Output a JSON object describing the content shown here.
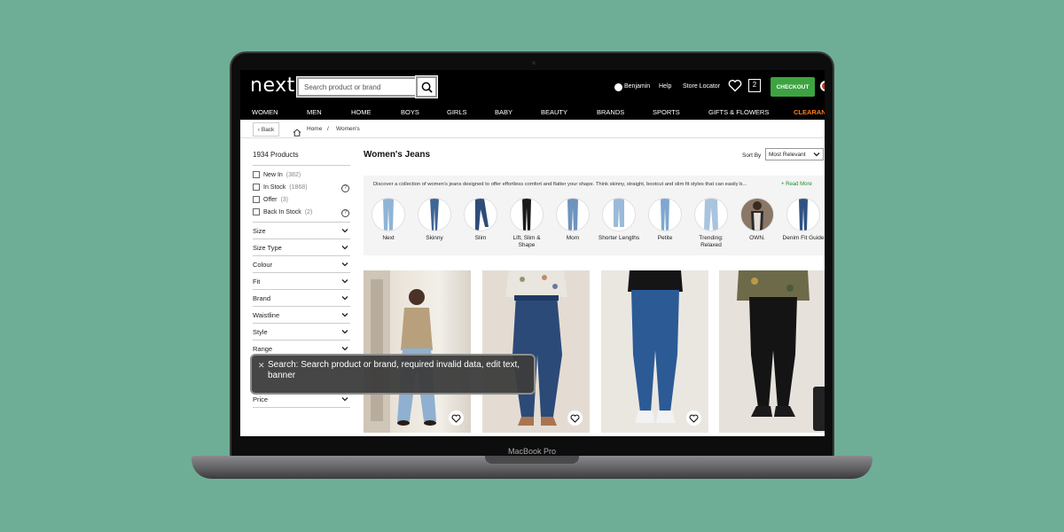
{
  "device": {
    "label": "MacBook Pro"
  },
  "header": {
    "logo": "next",
    "search_placeholder": "Search product or brand",
    "user_name": "Benjamin",
    "help": "Help",
    "store_locator": "Store Locator",
    "bag_count": "2",
    "checkout": "CHECKOUT"
  },
  "nav": [
    "WOMEN",
    "MEN",
    "HOME",
    "BOYS",
    "GIRLS",
    "BABY",
    "BEAUTY",
    "BRANDS",
    "SPORTS",
    "GIFTS & FLOWERS",
    "CLEARAN"
  ],
  "breadcrumb": {
    "back": "Back",
    "home": "Home",
    "separator": "/",
    "current": "Women's"
  },
  "sidebar": {
    "product_count": "1934 Products",
    "checkboxes": [
      {
        "label": "New In",
        "count": "(382)"
      },
      {
        "label": "In Stock",
        "count": "(1868)"
      },
      {
        "label": "Offer",
        "count": "(3)"
      },
      {
        "label": "Back In Stock",
        "count": "(2)"
      }
    ],
    "filters": [
      "Size",
      "Size Type",
      "Colour",
      "Fit",
      "Brand",
      "Waistline",
      "Style",
      "Range",
      "Price"
    ]
  },
  "main": {
    "title": "Women's Jeans",
    "sort_label": "Sort By",
    "sort_value": "Most Relevant",
    "promo_text": "Discover a collection of women's jeans designed to offer effortless comfort and flatter your shape. Think skinny, straight, bootcut and slim fit styles that can easily b...",
    "read_more": "+ Read More",
    "categories": [
      {
        "label": "Next",
        "color": "#8fb4d6"
      },
      {
        "label": "Skinny",
        "color": "#3f6594"
      },
      {
        "label": "Slim",
        "color": "#2e4d78"
      },
      {
        "label": "Lift, Slim & Shape",
        "color": "#1a1a1a"
      },
      {
        "label": "Mom",
        "color": "#6e93bd"
      },
      {
        "label": "Shorter Lengths",
        "color": "#9bbad9"
      },
      {
        "label": "Petite",
        "color": "#7fa6cf"
      },
      {
        "label": "Trending: Relaxed",
        "color": "#a9c4df"
      },
      {
        "label": "OWN.",
        "color": "#3a2a22"
      },
      {
        "label": "Denim Fit Guide",
        "color": "#2f5283"
      }
    ]
  },
  "voiceover": {
    "text": "Search: Search product or brand, required invalid data, edit text, banner"
  }
}
